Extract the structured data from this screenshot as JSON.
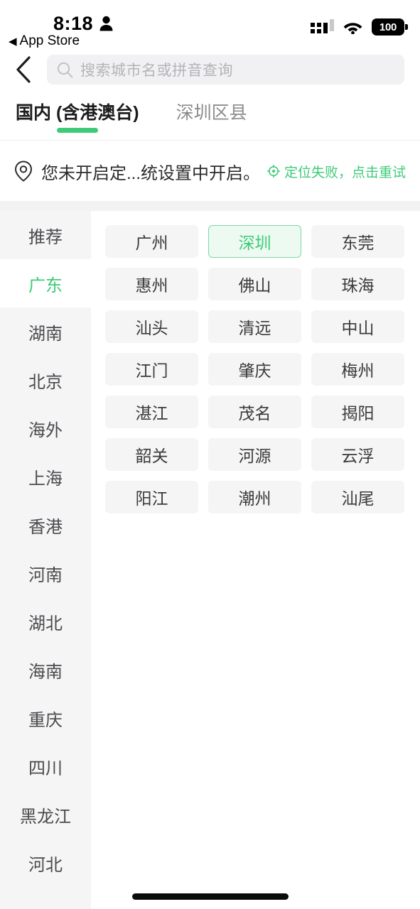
{
  "status_bar": {
    "time": "8:18",
    "person_icon": "person-icon",
    "signal_icon": "cellular-signal-icon",
    "wifi_icon": "wifi-icon",
    "battery_level": "100",
    "return_app_label": "App Store",
    "return_app_arrow": "◀"
  },
  "nav": {
    "back_icon": "chevron-left-icon"
  },
  "search": {
    "icon": "search-icon",
    "placeholder": "搜索城市名或拼音查询",
    "value": ""
  },
  "tabs": [
    {
      "label": "国内 (含港澳台)",
      "active": true
    },
    {
      "label": "深圳区县",
      "active": false
    }
  ],
  "location_notice": {
    "pin_icon": "location-pin-icon",
    "message": "您未开启定...统设置中开启。",
    "retry_icon": "crosshair-target-icon",
    "retry_label": "定位失败，点击重试"
  },
  "sidebar": {
    "items": [
      {
        "label": "推荐",
        "active": false
      },
      {
        "label": "广东",
        "active": true
      },
      {
        "label": "湖南",
        "active": false
      },
      {
        "label": "北京",
        "active": false
      },
      {
        "label": "海外",
        "active": false
      },
      {
        "label": "上海",
        "active": false
      },
      {
        "label": "香港",
        "active": false
      },
      {
        "label": "河南",
        "active": false
      },
      {
        "label": "湖北",
        "active": false
      },
      {
        "label": "海南",
        "active": false
      },
      {
        "label": "重庆",
        "active": false
      },
      {
        "label": "四川",
        "active": false
      },
      {
        "label": "黑龙江",
        "active": false
      },
      {
        "label": "河北",
        "active": false
      }
    ]
  },
  "cities": [
    {
      "label": "广州",
      "selected": false
    },
    {
      "label": "深圳",
      "selected": true
    },
    {
      "label": "东莞",
      "selected": false
    },
    {
      "label": "惠州",
      "selected": false
    },
    {
      "label": "佛山",
      "selected": false
    },
    {
      "label": "珠海",
      "selected": false
    },
    {
      "label": "汕头",
      "selected": false
    },
    {
      "label": "清远",
      "selected": false
    },
    {
      "label": "中山",
      "selected": false
    },
    {
      "label": "江门",
      "selected": false
    },
    {
      "label": "肇庆",
      "selected": false
    },
    {
      "label": "梅州",
      "selected": false
    },
    {
      "label": "湛江",
      "selected": false
    },
    {
      "label": "茂名",
      "selected": false
    },
    {
      "label": "揭阳",
      "selected": false
    },
    {
      "label": "韶关",
      "selected": false
    },
    {
      "label": "河源",
      "selected": false
    },
    {
      "label": "云浮",
      "selected": false
    },
    {
      "label": "阳江",
      "selected": false
    },
    {
      "label": "潮州",
      "selected": false
    },
    {
      "label": "汕尾",
      "selected": false
    }
  ],
  "colors": {
    "accent_green": "#3ecb78",
    "chip_bg": "#f5f5f6",
    "selected_chip_bg": "#ecfaf1",
    "selected_chip_border": "#7ed9a4"
  }
}
